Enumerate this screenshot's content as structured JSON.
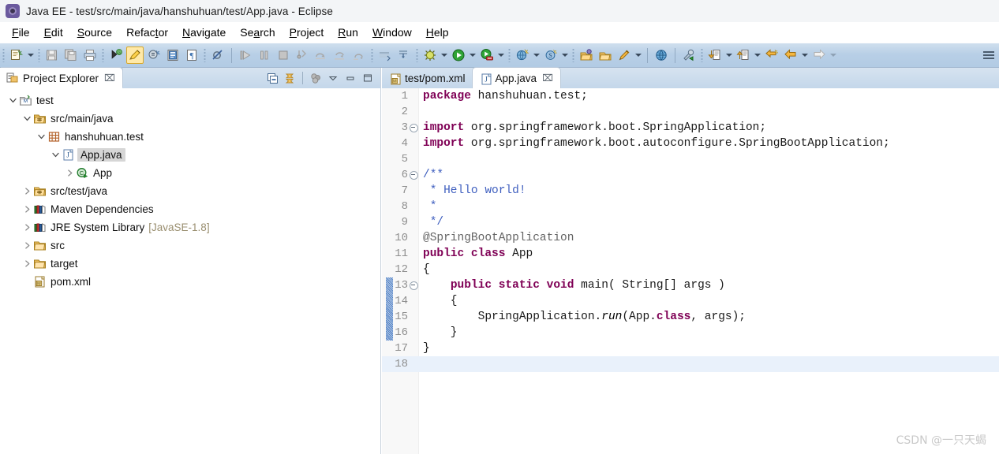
{
  "window": {
    "title": "Java EE - test/src/main/java/hanshuhuan/test/App.java - Eclipse",
    "icon": "eclipse-icon"
  },
  "menubar": {
    "items": [
      {
        "label": "File",
        "mnemonic": "F"
      },
      {
        "label": "Edit",
        "mnemonic": "E"
      },
      {
        "label": "Source",
        "mnemonic": "S"
      },
      {
        "label": "Refactor",
        "mnemonic": "t"
      },
      {
        "label": "Navigate",
        "mnemonic": "N"
      },
      {
        "label": "Search",
        "mnemonic": "a"
      },
      {
        "label": "Project",
        "mnemonic": "P"
      },
      {
        "label": "Run",
        "mnemonic": "R"
      },
      {
        "label": "Window",
        "mnemonic": "W"
      },
      {
        "label": "Help",
        "mnemonic": "H"
      }
    ]
  },
  "toolbar": {
    "groups": [
      {
        "buttons": [
          {
            "name": "new-icon",
            "kind": "new"
          },
          {
            "name": "new-dropdown-arrow",
            "kind": "arrow"
          }
        ]
      },
      {
        "buttons": [
          {
            "name": "save-icon",
            "kind": "save"
          },
          {
            "name": "save-all-icon",
            "kind": "saveall"
          },
          {
            "name": "print-icon",
            "kind": "print"
          }
        ]
      },
      {
        "buttons": [
          {
            "name": "toggle-breadcrumb-icon",
            "kind": "breadcrumb"
          },
          {
            "name": "toggle-mark-occurrences-icon",
            "kind": "marker",
            "active": true
          },
          {
            "name": "open-type-icon",
            "kind": "opentype"
          },
          {
            "name": "open-task-icon",
            "kind": "tasklist"
          },
          {
            "name": "show-whitespace-icon",
            "kind": "pilcrow"
          }
        ]
      },
      {
        "buttons": [
          {
            "name": "skip-breakpoints-icon",
            "kind": "skipbreak"
          }
        ]
      },
      {
        "buttons": [
          {
            "name": "resume-icon",
            "kind": "resume"
          },
          {
            "name": "suspend-icon",
            "kind": "suspend"
          },
          {
            "name": "terminate-icon",
            "kind": "terminate"
          },
          {
            "name": "step-into-icon",
            "kind": "stepinto"
          },
          {
            "name": "step-over-icon",
            "kind": "stepover"
          },
          {
            "name": "step-return-icon",
            "kind": "stepreturn"
          },
          {
            "name": "drop-to-frame-icon",
            "kind": "dropframe"
          }
        ]
      },
      {
        "buttons": [
          {
            "name": "new-java-package-icon",
            "kind": "newpkg"
          },
          {
            "name": "new-java-class-icon",
            "kind": "newclass"
          }
        ]
      },
      {
        "buttons": [
          {
            "name": "debug-icon",
            "kind": "debug"
          },
          {
            "name": "debug-dropdown-arrow",
            "kind": "arrow"
          },
          {
            "name": "run-icon",
            "kind": "run"
          },
          {
            "name": "run-dropdown-arrow",
            "kind": "arrow"
          },
          {
            "name": "run-as-server-icon",
            "kind": "runserver"
          },
          {
            "name": "run-server-dropdown-arrow",
            "kind": "arrow"
          }
        ]
      },
      {
        "buttons": [
          {
            "name": "new-web-project-icon",
            "kind": "webnew"
          },
          {
            "name": "web-dropdown-arrow",
            "kind": "arrow"
          },
          {
            "name": "search-icon",
            "kind": "searchglobe"
          },
          {
            "name": "search-dropdown-arrow",
            "kind": "arrow"
          }
        ]
      },
      {
        "buttons": [
          {
            "name": "open-perspective-icon",
            "kind": "openpersp"
          },
          {
            "name": "open-folder-icon",
            "kind": "openfolder"
          },
          {
            "name": "annotation-icon",
            "kind": "pencil"
          },
          {
            "name": "annotation-dropdown-arrow",
            "kind": "arrow"
          }
        ]
      },
      {
        "buttons": [
          {
            "name": "open-browser-icon",
            "kind": "globe"
          }
        ]
      },
      {
        "buttons": [
          {
            "name": "external-tools-icon",
            "kind": "exttools"
          }
        ]
      },
      {
        "buttons": [
          {
            "name": "previous-annotation-icon",
            "kind": "downarrowdoc"
          },
          {
            "name": "previous-annotation-dropdown-arrow",
            "kind": "arrow"
          },
          {
            "name": "next-annotation-icon",
            "kind": "uparrowdoc"
          },
          {
            "name": "next-annotation-dropdown-arrow",
            "kind": "arrow"
          },
          {
            "name": "last-edit-location-icon",
            "kind": "lastedit"
          },
          {
            "name": "back-icon",
            "kind": "back"
          },
          {
            "name": "back-dropdown-arrow",
            "kind": "arrow"
          },
          {
            "name": "forward-icon",
            "kind": "forward"
          },
          {
            "name": "forward-dropdown-arrow",
            "kind": "arrow-dim"
          }
        ]
      }
    ],
    "overflow_label": "toolbar-overflow"
  },
  "project_explorer": {
    "tab_label": "Project Explorer",
    "tab_icon": "project-explorer-icon",
    "close_glyph": "⌧",
    "tools": [
      {
        "name": "collapse-all-button",
        "kind": "collapse"
      },
      {
        "name": "link-with-editor-button",
        "kind": "link"
      },
      {
        "name": "focus-on-active-task-button",
        "kind": "focus"
      },
      {
        "name": "view-menu-button",
        "kind": "menu"
      },
      {
        "name": "minimize-button",
        "kind": "minimize"
      },
      {
        "name": "maximize-button",
        "kind": "maximize"
      }
    ],
    "tree": [
      {
        "label": "test",
        "indent": 0,
        "twisty": "open",
        "icon": "maven-project-icon",
        "selected": false,
        "suffix": ""
      },
      {
        "label": "src/main/java",
        "indent": 1,
        "twisty": "open",
        "icon": "source-folder-icon",
        "selected": false,
        "suffix": ""
      },
      {
        "label": "hanshuhuan.test",
        "indent": 2,
        "twisty": "open",
        "icon": "package-icon",
        "selected": false,
        "suffix": ""
      },
      {
        "label": "App.java",
        "indent": 3,
        "twisty": "open",
        "icon": "java-file-icon",
        "selected": true,
        "suffix": ""
      },
      {
        "label": "App",
        "indent": 4,
        "twisty": "closed",
        "icon": "java-class-run-icon",
        "selected": false,
        "suffix": ""
      },
      {
        "label": "src/test/java",
        "indent": 1,
        "twisty": "closed",
        "icon": "source-folder-icon",
        "selected": false,
        "suffix": ""
      },
      {
        "label": "Maven Dependencies",
        "indent": 1,
        "twisty": "closed",
        "icon": "library-icon",
        "selected": false,
        "suffix": ""
      },
      {
        "label": "JRE System Library",
        "indent": 1,
        "twisty": "closed",
        "icon": "library-icon",
        "selected": false,
        "suffix": "[JavaSE-1.8]"
      },
      {
        "label": "src",
        "indent": 1,
        "twisty": "closed",
        "icon": "folder-icon",
        "selected": false,
        "suffix": ""
      },
      {
        "label": "target",
        "indent": 1,
        "twisty": "closed",
        "icon": "folder-icon",
        "selected": false,
        "suffix": ""
      },
      {
        "label": "pom.xml",
        "indent": 1,
        "twisty": "none",
        "icon": "xml-file-icon",
        "selected": false,
        "suffix": ""
      }
    ]
  },
  "editor": {
    "tabs": [
      {
        "label": "test/pom.xml",
        "icon": "xml-file-icon",
        "active": false,
        "closable": false
      },
      {
        "label": "App.java",
        "icon": "java-file-icon",
        "active": true,
        "closable": true,
        "close_glyph": "⌧"
      }
    ],
    "file_name": "App.java",
    "cursor_line": 18,
    "change_bar_lines": [
      13,
      14,
      15,
      16
    ],
    "code_lines": [
      {
        "n": 1,
        "fold": false,
        "tokens": [
          {
            "t": "package ",
            "c": "kw"
          },
          {
            "t": "hanshuhuan.test;",
            "c": "plain"
          }
        ]
      },
      {
        "n": 2,
        "fold": false,
        "tokens": []
      },
      {
        "n": 3,
        "fold": true,
        "tokens": [
          {
            "t": "import ",
            "c": "kw"
          },
          {
            "t": "org.springframework.boot.SpringApplication;",
            "c": "plain"
          }
        ]
      },
      {
        "n": 4,
        "fold": false,
        "tokens": [
          {
            "t": "import ",
            "c": "kw"
          },
          {
            "t": "org.springframework.boot.autoconfigure.SpringBootApplication;",
            "c": "plain"
          }
        ]
      },
      {
        "n": 5,
        "fold": false,
        "tokens": []
      },
      {
        "n": 6,
        "fold": true,
        "tokens": [
          {
            "t": "/**",
            "c": "jdoc"
          }
        ]
      },
      {
        "n": 7,
        "fold": false,
        "tokens": [
          {
            "t": " * Hello world!",
            "c": "jdoc"
          }
        ]
      },
      {
        "n": 8,
        "fold": false,
        "tokens": [
          {
            "t": " *",
            "c": "jdoc"
          }
        ]
      },
      {
        "n": 9,
        "fold": false,
        "tokens": [
          {
            "t": " */",
            "c": "jdoc"
          }
        ]
      },
      {
        "n": 10,
        "fold": false,
        "tokens": [
          {
            "t": "@SpringBootApplication",
            "c": "anno"
          }
        ]
      },
      {
        "n": 11,
        "fold": false,
        "tokens": [
          {
            "t": "public class ",
            "c": "kw"
          },
          {
            "t": "App",
            "c": "plain"
          }
        ]
      },
      {
        "n": 12,
        "fold": false,
        "tokens": [
          {
            "t": "{",
            "c": "plain"
          }
        ]
      },
      {
        "n": 13,
        "fold": true,
        "tokens": [
          {
            "t": "    ",
            "c": "plain"
          },
          {
            "t": "public static void ",
            "c": "kw"
          },
          {
            "t": "main( String[] args )",
            "c": "plain"
          }
        ]
      },
      {
        "n": 14,
        "fold": false,
        "tokens": [
          {
            "t": "    {",
            "c": "plain"
          }
        ]
      },
      {
        "n": 15,
        "fold": false,
        "tokens": [
          {
            "t": "        SpringApplication.",
            "c": "plain"
          },
          {
            "t": "run",
            "c": "ital"
          },
          {
            "t": "(App.",
            "c": "plain"
          },
          {
            "t": "class",
            "c": "kw"
          },
          {
            "t": ", args);",
            "c": "plain"
          }
        ]
      },
      {
        "n": 16,
        "fold": false,
        "tokens": [
          {
            "t": "    }",
            "c": "plain"
          }
        ]
      },
      {
        "n": 17,
        "fold": false,
        "tokens": [
          {
            "t": "}",
            "c": "plain"
          }
        ]
      },
      {
        "n": 18,
        "fold": false,
        "tokens": []
      }
    ]
  },
  "watermark": {
    "text": "CSDN @一只天蝎"
  },
  "colors": {
    "toolbar_bg": "#b8cfe6",
    "tab_bg": "#c4d7ea",
    "keyword": "#7f0055",
    "javadoc": "#3f5fbf",
    "annotation": "#646464",
    "selection": "#d6d6d6",
    "cursor_line": "#e9f1fb",
    "change_bar": "#97b6dd",
    "watermark": "#c9c9c9"
  }
}
